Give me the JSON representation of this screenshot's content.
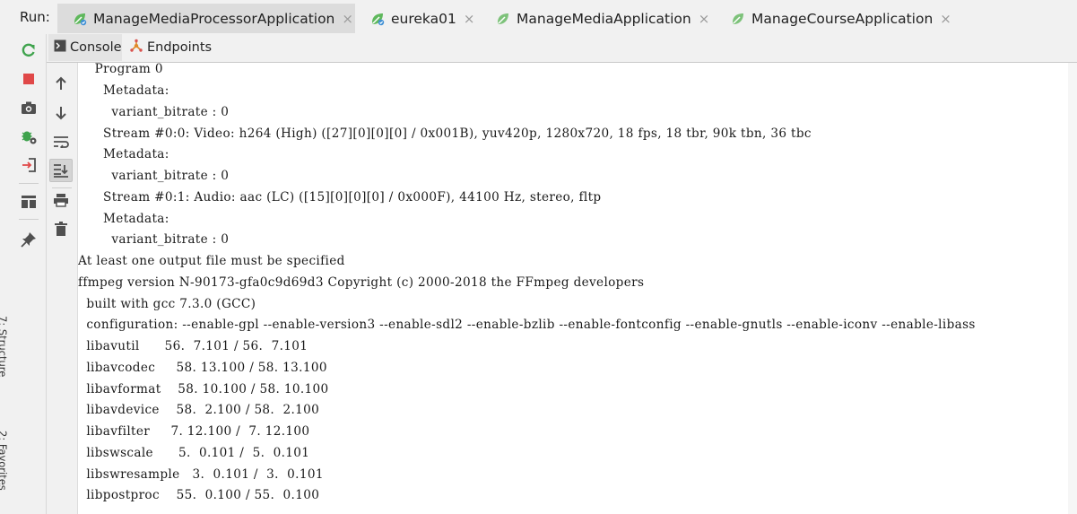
{
  "run_bar": {
    "label": "Run:",
    "tabs": [
      {
        "label": "ManageMediaProcessorApplication",
        "close": "×"
      },
      {
        "label": "eureka01",
        "close": "×"
      },
      {
        "label": "ManageMediaApplication",
        "close": "×"
      },
      {
        "label": "ManageCourseApplication",
        "close": "×"
      }
    ]
  },
  "subtabs": [
    {
      "label": "Console",
      "icon": "console-icon"
    },
    {
      "label": "Endpoints",
      "icon": "endpoints-icon"
    }
  ],
  "side_strip": {
    "structure_label": "7: Structure",
    "favorites_label": "2: Favorites"
  },
  "actions_col1": [
    "rerun-icon",
    "stop-icon",
    "camera-icon",
    "debug-settings-icon",
    "login-icon",
    "layout-icon",
    "pin-icon"
  ],
  "actions_col2": [
    "up-arrow-icon",
    "down-arrow-icon",
    "soft-wrap-icon",
    "scroll-to-end-icon",
    "print-icon",
    "trash-icon"
  ],
  "colors": {
    "accent_green": "#3fa34d",
    "stop_red": "#e04848",
    "toolbar_bg": "#f1f1f1"
  },
  "console": {
    "lines": [
      "    Program 0",
      "      Metadata:",
      "        variant_bitrate : 0",
      "      Stream #0:0: Video: h264 (High) ([27][0][0][0] / 0x001B), yuv420p, 1280x720, 18 fps, 18 tbr, 90k tbn, 36 tbc",
      "      Metadata:",
      "        variant_bitrate : 0",
      "      Stream #0:1: Audio: aac (LC) ([15][0][0][0] / 0x000F), 44100 Hz, stereo, fltp",
      "      Metadata:",
      "        variant_bitrate : 0",
      "At least one output file must be specified",
      "ffmpeg version N-90173-gfa0c9d69d3 Copyright (c) 2000-2018 the FFmpeg developers",
      "  built with gcc 7.3.0 (GCC)",
      "  configuration: --enable-gpl --enable-version3 --enable-sdl2 --enable-bzlib --enable-fontconfig --enable-gnutls --enable-iconv --enable-libass",
      "  libavutil      56.  7.101 / 56.  7.101",
      "  libavcodec     58. 13.100 / 58. 13.100",
      "  libavformat    58. 10.100 / 58. 10.100",
      "  libavdevice    58.  2.100 / 58.  2.100",
      "  libavfilter     7. 12.100 /  7. 12.100",
      "  libswscale      5.  0.101 /  5.  0.101",
      "  libswresample   3.  0.101 /  3.  0.101",
      "  libpostproc    55.  0.100 / 55.  0.100"
    ]
  }
}
